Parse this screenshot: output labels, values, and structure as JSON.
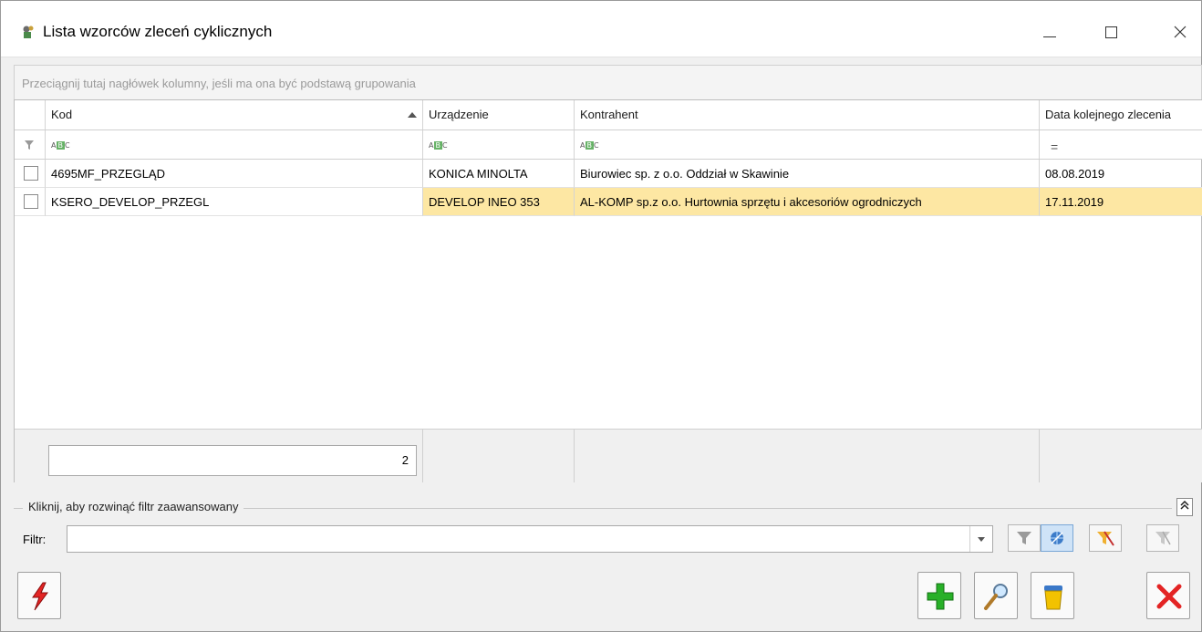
{
  "window": {
    "title": "Lista wzorców zleceń cyklicznych"
  },
  "grid": {
    "group_hint": "Przeciągnij tutaj nagłówek kolumny, jeśli ma ona być podstawą grupowania",
    "columns": [
      "Kod",
      "Urządzenie",
      "Kontrahent",
      "Data kolejnego zlecenia"
    ],
    "rows": [
      {
        "kod": "4695MF_PRZEGLĄD",
        "urzadzenie": "KONICA MINOLTA",
        "kontrahent": "Biurowiec sp. z o.o. Oddział w Skawinie",
        "data": "08.08.2019",
        "selected": false
      },
      {
        "kod": "KSERO_DEVELOP_PRZEGL",
        "urzadzenie": "DEVELOP INEO 353",
        "kontrahent": "AL-KOMP sp.z o.o. Hurtownia sprzętu i akcesoriów ogrodniczych",
        "data": "17.11.2019",
        "selected": true
      }
    ],
    "footer_count": "2",
    "selected_row_color": "#fde7a3"
  },
  "filter": {
    "advanced_label": "Kliknij, aby rozwinąć filtr zaawansowany",
    "label": "Filtr:",
    "value": ""
  },
  "icons": {
    "app": "app-icon",
    "filter_row": "filter-funnel-icon",
    "text_filter": "abc-text-filter-icon",
    "toolbar": [
      "funnel-icon",
      "globe-filter-icon",
      "funnel-clear-icon",
      "funnel-disabled-icon"
    ],
    "actions": [
      "lightning-icon",
      "add-plus-icon",
      "magnifier-icon",
      "trash-bin-icon",
      "cancel-x-icon"
    ]
  }
}
